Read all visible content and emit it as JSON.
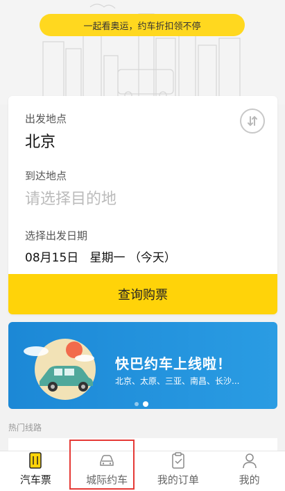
{
  "promo": {
    "text": "一起看奥运，约车折扣领不停"
  },
  "form": {
    "departure_label": "出发地点",
    "departure_value": "北京",
    "arrival_label": "到达地点",
    "arrival_placeholder": "请选择目的地",
    "date_label": "选择出发日期",
    "date_value": "08月15日   星期一 （今天）",
    "search_button": "查询购票",
    "swap_icon": "swap-arrows-icon"
  },
  "ad": {
    "title": "快巴约车上线啦！",
    "subtitle": "北京、太原、三亚、南昌、长沙...",
    "page_count": 2,
    "active_page": 2
  },
  "section": {
    "title": "热门线路"
  },
  "tabbar": {
    "items": [
      {
        "label": "汽车票",
        "icon": "ticket-icon",
        "active": true
      },
      {
        "label": "城际约车",
        "icon": "car-icon",
        "active": false
      },
      {
        "label": "我的订单",
        "icon": "clipboard-check-icon",
        "active": false
      },
      {
        "label": "我的",
        "icon": "user-icon",
        "active": false
      }
    ]
  },
  "colors": {
    "accent": "#ffd309",
    "ad_background": "#2a9ce3",
    "highlight": "#e53935"
  }
}
